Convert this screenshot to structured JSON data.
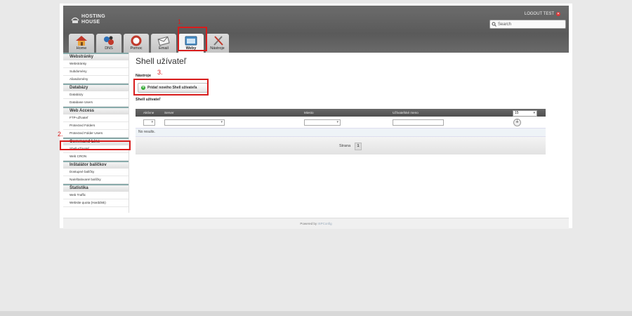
{
  "header": {
    "logo_line1": "HOSTING",
    "logo_line2": "HOUSE",
    "logout": "LOGOUT TEST",
    "search_placeholder": "Search"
  },
  "tabs": [
    {
      "label": "Home",
      "icon": "home-icon"
    },
    {
      "label": "DNS",
      "icon": "dns-icon"
    },
    {
      "label": "Pomoc",
      "icon": "help-icon"
    },
    {
      "label": "Email",
      "icon": "email-icon"
    },
    {
      "label": "Weby",
      "icon": "web-icon",
      "active": true
    },
    {
      "label": "Nástroje",
      "icon": "tools-icon"
    }
  ],
  "sidebar": {
    "sections": [
      {
        "title": "Webstránky",
        "items": [
          "Webstránky",
          "Subdomény",
          "Aliasdomény"
        ]
      },
      {
        "title": "Databázy",
        "items": [
          "Databázy",
          "Database Users"
        ]
      },
      {
        "title": "Web Access",
        "items": [
          "FTP-užívateľ",
          "Protected Folders",
          "Protected Folder Users"
        ]
      },
      {
        "title": "Command Line",
        "items": [
          "Shell-užívateľ",
          "Web CRON"
        ]
      },
      {
        "title": "Inštalátor balíčkov",
        "items": [
          "Dostupné balíčky",
          "Nainštalované balíčky"
        ]
      },
      {
        "title": "Štatistika",
        "items": [
          "Web Traffic",
          "Website quota (Harddisk)"
        ]
      }
    ]
  },
  "content": {
    "title": "Shell užívateľ",
    "tools_label": "Nástroje",
    "add_button": "Pridať nového Shell užívateľa",
    "list_label": "Shell užívateľ",
    "columns": [
      "Aktívne",
      "Server",
      "Miesto",
      "Užívateľské meno"
    ],
    "per_page": "15",
    "no_results": "No results.",
    "pager_label": "Strana",
    "pager_page": "1"
  },
  "footer": {
    "powered_by": "Powered by",
    "brand": "ISPConfig"
  },
  "annotations": [
    "1.",
    "2.",
    "3."
  ],
  "colors": {
    "annotation": "#d81c1c",
    "header": "#5f5f5f"
  }
}
